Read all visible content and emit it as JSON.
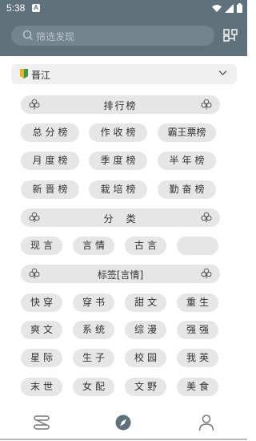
{
  "status": {
    "time": "5:38",
    "app_badge": "A"
  },
  "search": {
    "placeholder": "筛选发现"
  },
  "source": {
    "label": "晋江"
  },
  "sections": {
    "ranking": "排行榜",
    "category": "分　类",
    "tags": "标签[言情]"
  },
  "ranking_items": [
    "总分榜",
    "作收榜",
    "霸王票榜",
    "月度榜",
    "季度榜",
    "半年榜",
    "新晋榜",
    "栽培榜",
    "勤奋榜"
  ],
  "category_items": [
    "现言",
    "言情",
    "古言",
    ""
  ],
  "tag_items": [
    "快穿",
    "穿书",
    "甜文",
    "重生",
    "爽文",
    "系统",
    "综漫",
    "强强",
    "星际",
    "生子",
    "校园",
    "我英",
    "末世",
    "女配",
    "文野",
    "美食"
  ],
  "colors": {
    "header": "#5f717b",
    "chip": "#e6e6e6",
    "accent": "#5f717b"
  },
  "nav": [
    "bookshelf-icon",
    "explore-icon",
    "profile-icon"
  ]
}
